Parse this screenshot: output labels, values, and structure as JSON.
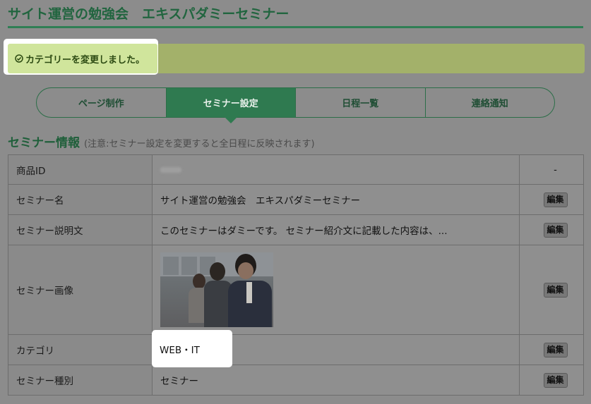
{
  "page": {
    "title": "サイト運営の勉強会　エキスパダミーセミナー"
  },
  "alert": {
    "message": "カテゴリーを変更しました。",
    "icon": "check-circle-icon"
  },
  "tabs": [
    {
      "label": "ページ制作",
      "active": false
    },
    {
      "label": "セミナー設定",
      "active": true
    },
    {
      "label": "日程一覧",
      "active": false
    },
    {
      "label": "連絡通知",
      "active": false
    }
  ],
  "section": {
    "title": "セミナー情報",
    "note": "(注意:セミナー設定を変更すると全日程に反映されます)"
  },
  "rows": [
    {
      "label": "商品ID",
      "value": "",
      "action": "-"
    },
    {
      "label": "セミナー名",
      "value": "サイト運営の勉強会　エキスパダミーセミナー",
      "action": "編集"
    },
    {
      "label": "セミナー説明文",
      "value": "このセミナーはダミーです。 セミナー紹介文に記載した内容は、...",
      "action": "編集"
    },
    {
      "label": "セミナー画像",
      "value": "",
      "action": "編集"
    },
    {
      "label": "カテゴリ",
      "value": "WEB・IT",
      "action": "編集"
    },
    {
      "label": "セミナー種別",
      "value": "セミナー",
      "action": "編集"
    }
  ]
}
